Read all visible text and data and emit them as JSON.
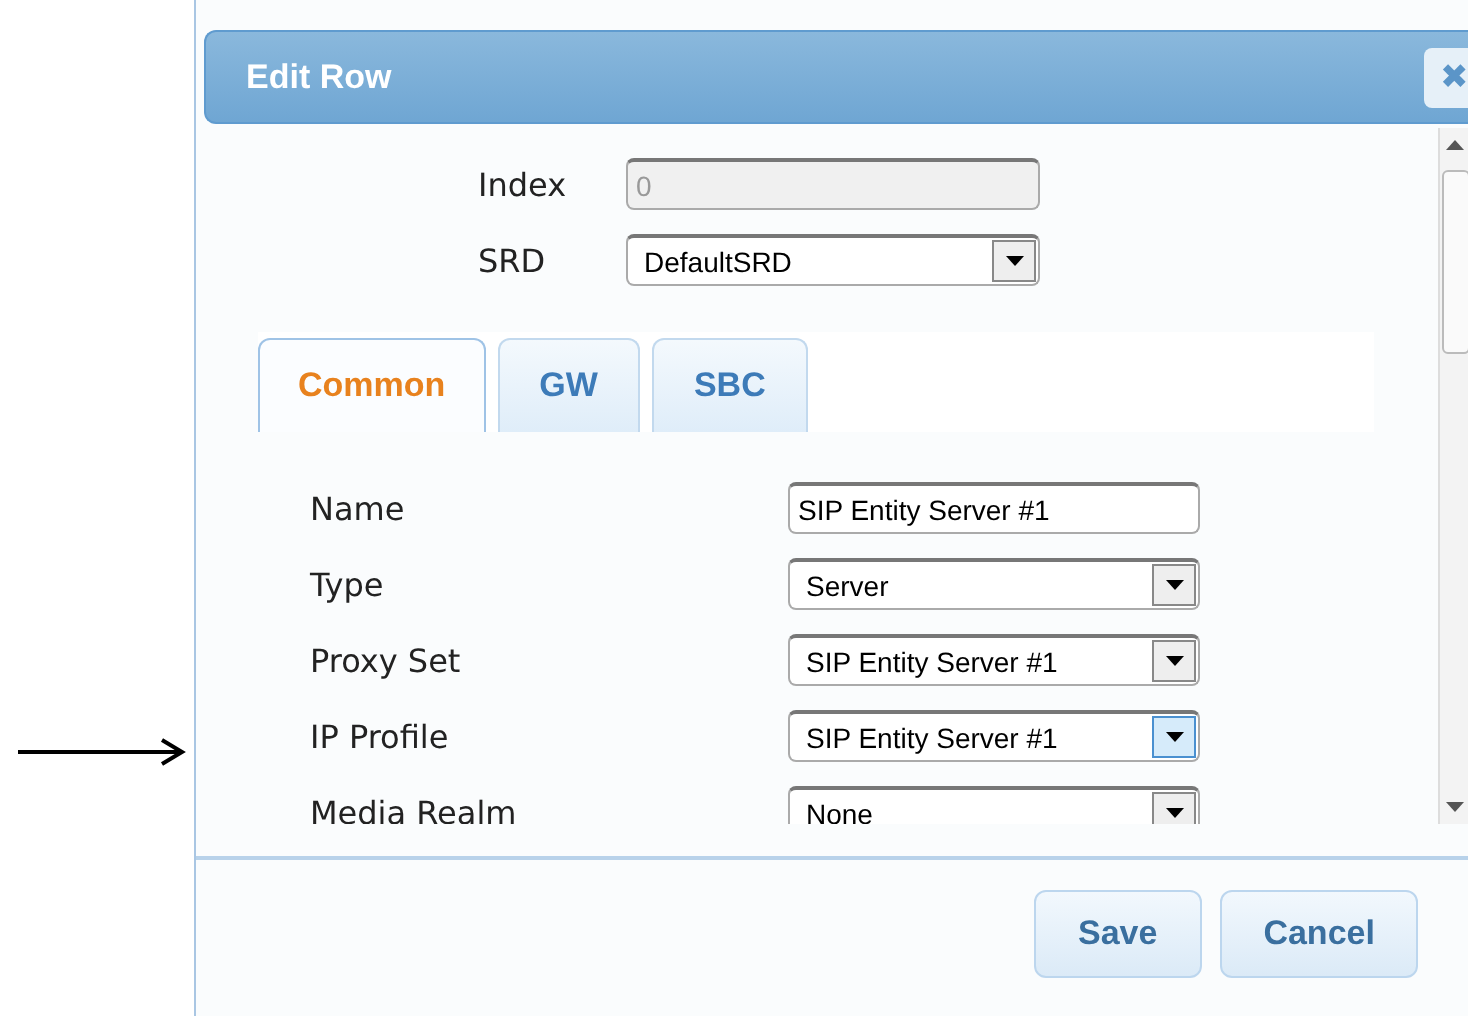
{
  "dialog": {
    "title": "Edit Row",
    "close_icon": "✖"
  },
  "top_fields": [
    {
      "label": "Index",
      "kind": "text",
      "value": "0",
      "disabled": true
    },
    {
      "label": "SRD",
      "kind": "select",
      "value": "DefaultSRD",
      "focused": false
    }
  ],
  "tabs": [
    {
      "label": "Common",
      "selected": true
    },
    {
      "label": "GW",
      "selected": false
    },
    {
      "label": "SBC",
      "selected": false
    }
  ],
  "fields": [
    {
      "label": "Name",
      "kind": "text",
      "value": "SIP Entity Server #1",
      "disabled": false
    },
    {
      "label": "Type",
      "kind": "select",
      "value": "Server",
      "focused": false
    },
    {
      "label": "Proxy Set",
      "kind": "select",
      "value": "SIP Entity Server #1",
      "focused": false
    },
    {
      "label": "IP Profile",
      "kind": "select",
      "value": "SIP Entity Server #1",
      "focused": true
    },
    {
      "label": "Media Realm",
      "kind": "select",
      "value": "None",
      "focused": false
    }
  ],
  "buttons": [
    "Save",
    "Cancel"
  ]
}
